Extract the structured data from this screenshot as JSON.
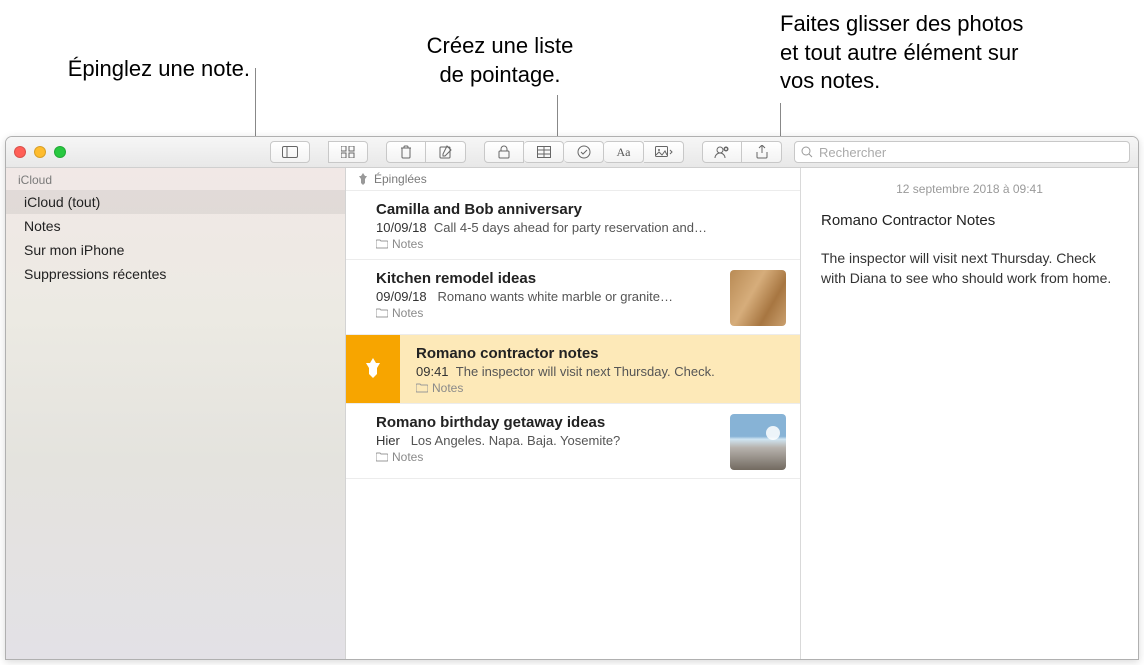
{
  "callouts": {
    "pin": "Épinglez une note.",
    "checklist": "Créez une liste\nde pointage.",
    "drag": "Faites glisser des photos\net tout autre élément sur\nvos notes."
  },
  "search": {
    "placeholder": "Rechercher"
  },
  "sidebar": {
    "header": "iCloud",
    "items": [
      {
        "label": "iCloud (tout)",
        "selected": true
      },
      {
        "label": "Notes"
      },
      {
        "label": "Sur mon iPhone"
      },
      {
        "label": "Suppressions récentes"
      }
    ]
  },
  "list": {
    "pinned_label": "Épinglées",
    "folder_label": "Notes",
    "items": [
      {
        "title": "Camilla and Bob anniversary",
        "date": "10/09/18",
        "snippet": "Call 4-5 days ahead for party reservation and…"
      },
      {
        "title": "Kitchen remodel ideas",
        "date": "09/09/18",
        "snippet": "Romano wants white marble or granite…",
        "thumb": "wood"
      },
      {
        "title": "Romano contractor notes",
        "date": "09:41",
        "snippet": "The inspector will visit next Thursday. Check.",
        "selected": true,
        "pin": true
      },
      {
        "title": "Romano birthday getaway ideas",
        "date": "Hier",
        "snippet": "Los Angeles. Napa. Baja. Yosemite?",
        "thumb": "beach"
      }
    ]
  },
  "editor": {
    "timestamp": "12 septembre 2018 à 09:41",
    "title": "Romano Contractor Notes",
    "body": "The inspector will visit next Thursday. Check with Diana to see who should work from home."
  }
}
